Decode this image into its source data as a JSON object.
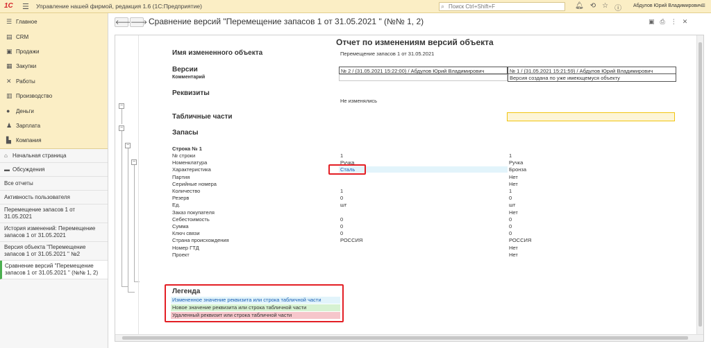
{
  "app": {
    "logo": "1С",
    "title": "Управление нашей фирмой, редакция 1.6  (1С:Предприятие)",
    "search_placeholder": "Поиск Ctrl+Shift+F",
    "user": "Абдулов Юрий Владимирович",
    "colors": {
      "topbar": "#fbeec5",
      "accent": "#e31e24",
      "active": "#4caf50"
    }
  },
  "sidebar": {
    "sections": [
      {
        "label": "Главное",
        "icon": "menu-icon"
      },
      {
        "label": "CRM",
        "icon": "crm-icon"
      },
      {
        "label": "Продажи",
        "icon": "cart-icon"
      },
      {
        "label": "Закупки",
        "icon": "truck-icon"
      },
      {
        "label": "Работы",
        "icon": "tools-icon"
      },
      {
        "label": "Производство",
        "icon": "factory-icon"
      },
      {
        "label": "Деньги",
        "icon": "coin-icon"
      },
      {
        "label": "Зарплата",
        "icon": "people-icon"
      },
      {
        "label": "Компания",
        "icon": "building-icon"
      }
    ],
    "nav": [
      {
        "label": "Начальная страница",
        "icon": "home-icon"
      },
      {
        "label": "Обсуждения",
        "icon": "chat-icon"
      },
      {
        "label": "Все отчеты"
      },
      {
        "label": "Активность пользователя"
      }
    ],
    "open_windows": [
      "Перемещение запасов 1 от 31.05.2021",
      "История изменений: Перемещение запасов 1 от 31.05.2021",
      "Версия объекта \"Перемещение запасов 1 от 31.05.2021 \" №2",
      "Сравнение версий \"Перемещение запасов 1 от 31.05.2021 \" (№№ 1, 2)"
    ]
  },
  "main": {
    "title": "Сравнение версий \"Перемещение запасов 1 от 31.05.2021 \" (№№ 1, 2)",
    "report": {
      "title": "Отчет по изменениям версий объекта",
      "object_label": "Имя измененного объекта",
      "object_value": "Перемещение запасов 1 от 31.05.2021",
      "versions_label": "Версии",
      "comment_label": "Комментарий",
      "version_2": "№ 2 / (31.05.2021 15:22:00) / Абдулов Юрий Владимирович",
      "version_1": "№ 1 / (31.05.2021 15:21:59) / Абдулов Юрий Владимирович",
      "version_1_comment": "Версия создана по уже имеющемуся объекту",
      "attributes_label": "Реквизиты",
      "attributes_value": "Не изменялись",
      "tables_label": "Табличные части",
      "stocks_label": "Запасы",
      "row_label": "Строка № 1",
      "rows": [
        {
          "name": "№ строки",
          "v2": "1",
          "v1": "1"
        },
        {
          "name": "Номенклатура",
          "v2": "Ручка",
          "v1": "Ручка"
        },
        {
          "name": "Характеристика",
          "v2": "Сталь",
          "v1": "Бронза",
          "changed": true
        },
        {
          "name": "Партия",
          "v2": "",
          "v1": "Нет"
        },
        {
          "name": "Серийные номера",
          "v2": "",
          "v1": "Нет"
        },
        {
          "name": "Количество",
          "v2": "1",
          "v1": "1"
        },
        {
          "name": "Резерв",
          "v2": "0",
          "v1": "0"
        },
        {
          "name": "Ед.",
          "v2": "шт",
          "v1": "шт"
        },
        {
          "name": "Заказ покупателя",
          "v2": "",
          "v1": "Нет"
        },
        {
          "name": "Себестоимость",
          "v2": "0",
          "v1": "0"
        },
        {
          "name": "Сумма",
          "v2": "0",
          "v1": "0"
        },
        {
          "name": "Ключ связи",
          "v2": "0",
          "v1": "0"
        },
        {
          "name": "Страна происхождения",
          "v2": "РОССИЯ",
          "v1": "РОССИЯ"
        },
        {
          "name": "Номер ГТД",
          "v2": "",
          "v1": "Нет"
        },
        {
          "name": "Проект",
          "v2": "",
          "v1": "Нет"
        }
      ],
      "legend": {
        "title": "Легенда",
        "items": [
          {
            "label": "Измененное значение реквизита или строка табличной части",
            "bg": "#e2f4fb",
            "fg": "#1a5fb4"
          },
          {
            "label": "Новое значение реквизита или строка табличной части",
            "bg": "#d6f2d2",
            "fg": "#333333"
          },
          {
            "label": "Удаленный реквизит или строка табличной части",
            "bg": "#f6c6cb",
            "fg": "#333333"
          }
        ]
      }
    }
  }
}
